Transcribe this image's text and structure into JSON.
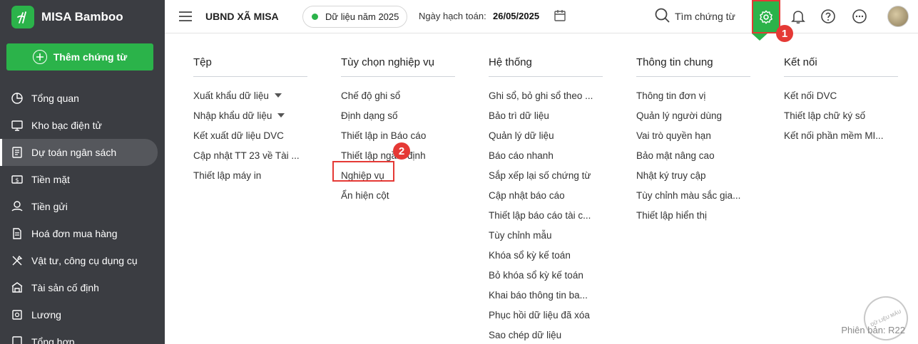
{
  "brand": {
    "name": "MISA Bamboo"
  },
  "sidebar": {
    "add_button": "Thêm chứng từ",
    "items": [
      {
        "label": "Tổng quan",
        "icon": "pie-chart-icon"
      },
      {
        "label": "Kho bạc điện tử",
        "icon": "monitor-icon"
      },
      {
        "label": "Dự toán ngân sách",
        "icon": "budget-icon",
        "active": true
      },
      {
        "label": "Tiền mặt",
        "icon": "cash-icon"
      },
      {
        "label": "Tiền gửi",
        "icon": "deposit-icon"
      },
      {
        "label": "Hoá đơn mua hàng",
        "icon": "invoice-icon"
      },
      {
        "label": "Vật tư, công cụ dụng cụ",
        "icon": "tools-icon"
      },
      {
        "label": "Tài sản cố định",
        "icon": "building-icon"
      },
      {
        "label": "Lương",
        "icon": "salary-icon"
      },
      {
        "label": "Tổng hợp",
        "icon": "summary-icon"
      }
    ]
  },
  "header": {
    "org": "UBND XÃ MISA",
    "data_year": "Dữ liệu năm 2025",
    "date_label": "Ngày hạch toán:",
    "date_value": "26/05/2025",
    "search": "Tìm chứng từ"
  },
  "badges": {
    "one": "1",
    "two": "2"
  },
  "menu": {
    "columns": [
      {
        "title": "Tệp",
        "items": [
          "Xuất khẩu dữ liệu",
          "Nhập khẩu dữ liệu",
          "Kết xuất dữ liệu DVC",
          "Cập nhật TT 23 về Tài ...",
          "Thiết lập máy in"
        ]
      },
      {
        "title": "Tùy chọn nghiệp vụ",
        "items": [
          "Chế độ ghi sổ",
          "Định dạng số",
          "Thiết lập in Báo cáo",
          "Thiết lập ngầm định",
          "Nghiệp vụ",
          "Ẩn hiện cột"
        ]
      },
      {
        "title": "Hệ thống",
        "items": [
          "Ghi sổ, bỏ ghi sổ theo ...",
          "Bảo trì dữ liệu",
          "Quản lý dữ liệu",
          "Báo cáo nhanh",
          "Sắp xếp lại số chứng từ",
          "Cập nhật báo cáo",
          "Thiết lập báo cáo tài c...",
          "Tùy chỉnh mẫu",
          "Khóa sổ kỳ kế toán",
          "Bỏ khóa sổ kỳ kế toán",
          "Khai báo thông tin ba...",
          "Phục hồi dữ liệu đã xóa",
          "Sao chép dữ liệu"
        ]
      },
      {
        "title": "Thông tin chung",
        "items": [
          "Thông tin đơn vị",
          "Quản lý người dùng",
          "Vai trò quyền hạn",
          "Bảo mật nâng cao",
          "Nhật ký truy cập",
          "Tùy chỉnh màu sắc gia...",
          "Thiết lập hiển thị"
        ]
      },
      {
        "title": "Kết nối",
        "items": [
          "Kết nối DVC",
          "Thiết lập chữ ký số",
          "Kết nối phần mềm MI..."
        ]
      }
    ]
  },
  "version": "Phiên bản: R22",
  "watermark": "DỮ LIỆU MẪU",
  "colors": {
    "sidebar": "#3b3d42",
    "accent": "#2bb34a",
    "highlight": "#e53935"
  }
}
